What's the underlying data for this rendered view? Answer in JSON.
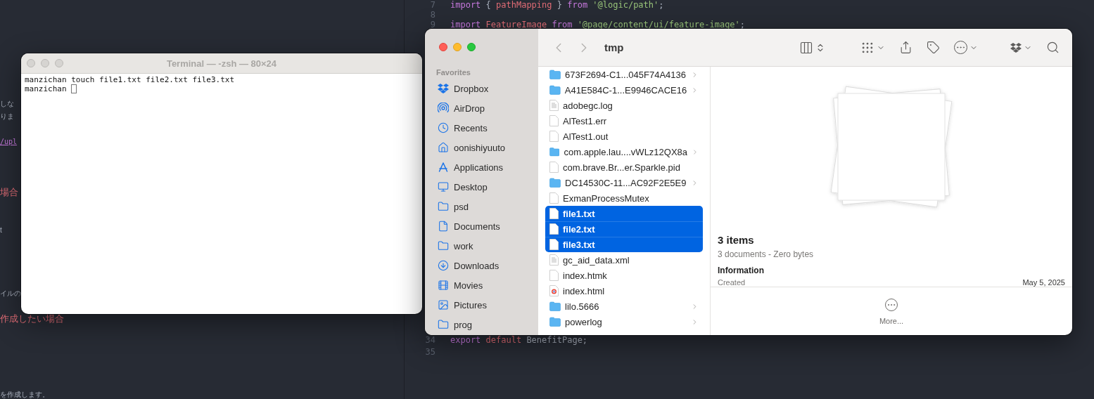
{
  "left_editor": {
    "lines": [
      {
        "text": "しな",
        "kind": "plain"
      },
      {
        "text": "りま",
        "kind": "plain"
      },
      {
        "text": "/upl",
        "kind": "link"
      },
      {
        "text": "場合",
        "kind": "heading"
      },
      {
        "text": "t",
        "kind": "plain"
      },
      {
        "text": "イルの",
        "kind": "plain"
      },
      {
        "text": "作成したい場合",
        "kind": "heading"
      },
      {
        "text": "を作成します。",
        "kind": "plain"
      }
    ]
  },
  "right_editor": {
    "top_lines": [
      {
        "number": "7",
        "tokens": [
          {
            "text": "import",
            "kind": "keyword"
          },
          {
            "text": " { ",
            "kind": "plain"
          },
          {
            "text": "pathMapping",
            "kind": "identifier"
          },
          {
            "text": " } ",
            "kind": "plain"
          },
          {
            "text": "from",
            "kind": "keyword"
          },
          {
            "text": " '@logic/path'",
            "kind": "string"
          },
          {
            "text": ";",
            "kind": "plain"
          }
        ]
      },
      {
        "number": "8"
      },
      {
        "number": "9",
        "tokens": [
          {
            "text": "import",
            "kind": "keyword"
          },
          {
            "text": " FeatureImage",
            "kind": "identifier"
          },
          {
            "text": " from",
            "kind": "keyword"
          },
          {
            "text": " '@page/content/ui/feature-image'",
            "kind": "string"
          },
          {
            "text": ";",
            "kind": "plain"
          }
        ]
      }
    ],
    "bottom_lines": [
      {
        "number": "34",
        "tokens": [
          {
            "text": "export",
            "kind": "keyword"
          },
          {
            "text": " default",
            "kind": "identifier"
          },
          {
            "text": " BenefitPage;",
            "kind": "plain"
          }
        ]
      },
      {
        "number": "35"
      }
    ]
  },
  "terminal": {
    "title": "Terminal — -zsh — 80×24",
    "lines": [
      {
        "text": "manzichan touch file1.txt file2.txt file3.txt",
        "cursor": false
      },
      {
        "text": "manzichan ",
        "cursor": true
      }
    ]
  },
  "finder": {
    "title": "tmp",
    "sidebar": {
      "section": "Favorites",
      "items": [
        {
          "label": "Dropbox"
        },
        {
          "label": "AirDrop"
        },
        {
          "label": "Recents"
        },
        {
          "label": "oonishiyuuto"
        },
        {
          "label": "Applications"
        },
        {
          "label": "Desktop"
        },
        {
          "label": "psd"
        },
        {
          "label": "Documents"
        },
        {
          "label": "work"
        },
        {
          "label": "Downloads"
        },
        {
          "label": "Movies"
        },
        {
          "label": "Pictures"
        },
        {
          "label": "prog"
        }
      ]
    },
    "files": [
      {
        "name": "673F2694-C1...045F74A4136",
        "kind": "folder",
        "selected": false
      },
      {
        "name": "A41E584C-1...E9946CACE16",
        "kind": "folder",
        "selected": false
      },
      {
        "name": "adobegc.log",
        "kind": "log",
        "selected": false
      },
      {
        "name": "AlTest1.err",
        "kind": "document",
        "selected": false
      },
      {
        "name": "AlTest1.out",
        "kind": "document",
        "selected": false
      },
      {
        "name": "com.apple.lau....vWLz12QX8a",
        "kind": "folder",
        "selected": false
      },
      {
        "name": "com.brave.Br...er.Sparkle.pid",
        "kind": "document",
        "selected": false
      },
      {
        "name": "DC14530C-11...AC92F2E5E9",
        "kind": "folder",
        "selected": false
      },
      {
        "name": "ExmanProcessMutex",
        "kind": "document",
        "selected": false
      },
      {
        "name": "file1.txt",
        "kind": "document",
        "selected": true
      },
      {
        "name": "file2.txt",
        "kind": "document",
        "selected": true
      },
      {
        "name": "file3.txt",
        "kind": "document",
        "selected": true
      },
      {
        "name": "gc_aid_data.xml",
        "kind": "log",
        "selected": false
      },
      {
        "name": "index.htmk",
        "kind": "document",
        "selected": false
      },
      {
        "name": "index.html",
        "kind": "web",
        "selected": false
      },
      {
        "name": "lilo.5666",
        "kind": "folder",
        "selected": false
      },
      {
        "name": "powerlog",
        "kind": "folder",
        "selected": false
      }
    ],
    "preview": {
      "title": "3 items",
      "subtitle": "3 documents - Zero bytes",
      "section": "Information",
      "rows": [
        {
          "label": "Created",
          "value": "May 5, 2025"
        }
      ],
      "more": "More..."
    }
  }
}
